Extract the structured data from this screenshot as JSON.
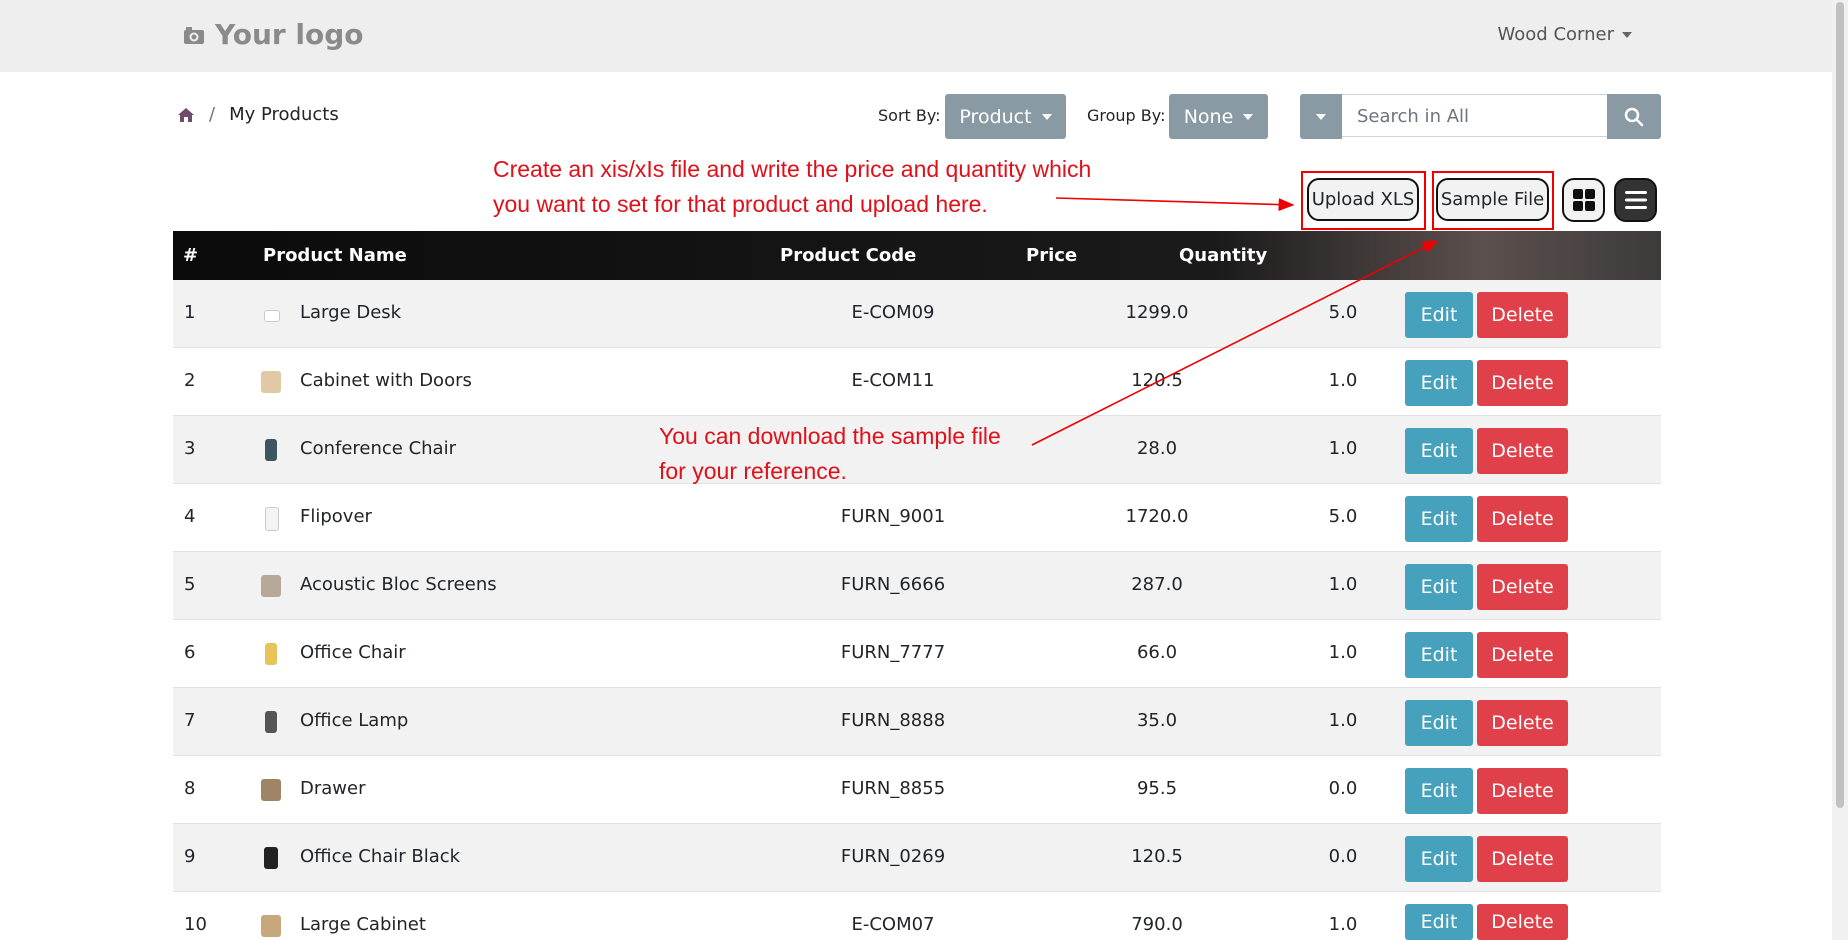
{
  "header": {
    "logo_text": "Your logo",
    "user_menu": "Wood Corner"
  },
  "breadcrumb": {
    "page": "My Products"
  },
  "controls": {
    "sort_label": "Sort By:",
    "sort_value": "Product",
    "group_label": "Group By:",
    "group_value": "None",
    "search_placeholder": "Search in All"
  },
  "actions": {
    "upload_label": "Upload XLS",
    "sample_label": "Sample File"
  },
  "annotations": {
    "upload_line1": "Create an xis/xIs file and write the price and quantity which",
    "upload_line2": "you want to set for that product and upload here.",
    "sample_line1": "You can download the sample file",
    "sample_line2": "for your reference."
  },
  "table": {
    "headers": {
      "num": "#",
      "name": "Product Name",
      "code": "Product Code",
      "price": "Price",
      "qty": "Quantity"
    },
    "edit_label": "Edit",
    "delete_label": "Delete",
    "rows": [
      {
        "num": "1",
        "name": "Large Desk",
        "code": "E-COM09",
        "price": "1299.0",
        "qty": "5.0"
      },
      {
        "num": "2",
        "name": "Cabinet with Doors",
        "code": "E-COM11",
        "price": "120.5",
        "qty": "1.0"
      },
      {
        "num": "3",
        "name": "Conference Chair",
        "code": "",
        "price": "28.0",
        "qty": "1.0"
      },
      {
        "num": "4",
        "name": "Flipover",
        "code": "FURN_9001",
        "price": "1720.0",
        "qty": "5.0"
      },
      {
        "num": "5",
        "name": "Acoustic Bloc Screens",
        "code": "FURN_6666",
        "price": "287.0",
        "qty": "1.0"
      },
      {
        "num": "6",
        "name": "Office Chair",
        "code": "FURN_7777",
        "price": "66.0",
        "qty": "1.0"
      },
      {
        "num": "7",
        "name": "Office Lamp",
        "code": "FURN_8888",
        "price": "35.0",
        "qty": "1.0"
      },
      {
        "num": "8",
        "name": "Drawer",
        "code": "FURN_8855",
        "price": "95.5",
        "qty": "0.0"
      },
      {
        "num": "9",
        "name": "Office Chair Black",
        "code": "FURN_0269",
        "price": "120.5",
        "qty": "0.0"
      },
      {
        "num": "10",
        "name": "Large Cabinet",
        "code": "E-COM07",
        "price": "790.0",
        "qty": "1.0"
      }
    ]
  },
  "colors": {
    "edit": "#46a1bd",
    "delete": "#df4049",
    "annotation": "#e0101a",
    "control_grey": "#8a9aa5"
  }
}
